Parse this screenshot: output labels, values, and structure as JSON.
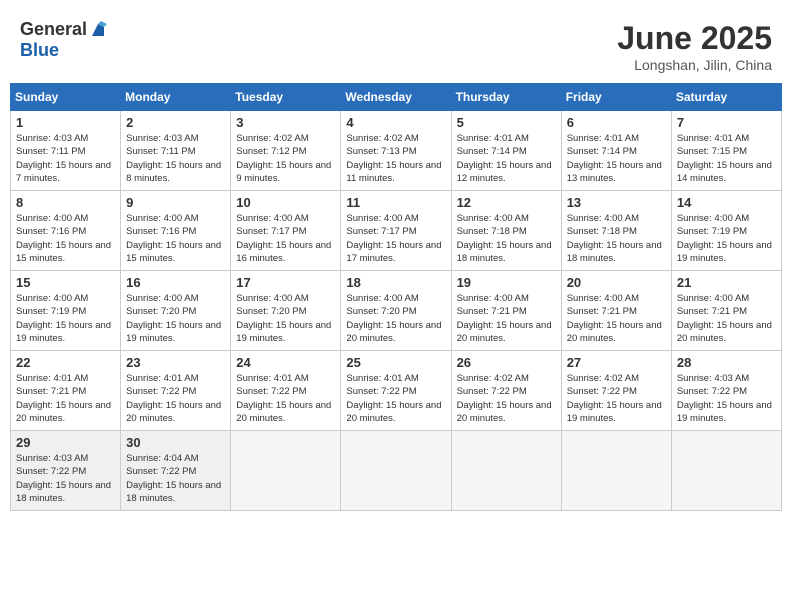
{
  "header": {
    "logo_general": "General",
    "logo_blue": "Blue",
    "title": "June 2025",
    "location": "Longshan, Jilin, China"
  },
  "calendar": {
    "days_of_week": [
      "Sunday",
      "Monday",
      "Tuesday",
      "Wednesday",
      "Thursday",
      "Friday",
      "Saturday"
    ],
    "weeks": [
      [
        null,
        null,
        null,
        null,
        null,
        null,
        null
      ]
    ],
    "cells": [
      {
        "day": null,
        "empty": true
      },
      {
        "day": null,
        "empty": true
      },
      {
        "day": null,
        "empty": true
      },
      {
        "day": null,
        "empty": true
      },
      {
        "day": null,
        "empty": true
      },
      {
        "day": null,
        "empty": true
      },
      {
        "day": null,
        "empty": true
      }
    ],
    "days": [
      {
        "num": "1",
        "sunrise": "4:03 AM",
        "sunset": "7:11 PM",
        "daylight": "15 hours and 7 minutes."
      },
      {
        "num": "2",
        "sunrise": "4:03 AM",
        "sunset": "7:11 PM",
        "daylight": "15 hours and 8 minutes."
      },
      {
        "num": "3",
        "sunrise": "4:02 AM",
        "sunset": "7:12 PM",
        "daylight": "15 hours and 9 minutes."
      },
      {
        "num": "4",
        "sunrise": "4:02 AM",
        "sunset": "7:13 PM",
        "daylight": "15 hours and 11 minutes."
      },
      {
        "num": "5",
        "sunrise": "4:01 AM",
        "sunset": "7:14 PM",
        "daylight": "15 hours and 12 minutes."
      },
      {
        "num": "6",
        "sunrise": "4:01 AM",
        "sunset": "7:14 PM",
        "daylight": "15 hours and 13 minutes."
      },
      {
        "num": "7",
        "sunrise": "4:01 AM",
        "sunset": "7:15 PM",
        "daylight": "15 hours and 14 minutes."
      },
      {
        "num": "8",
        "sunrise": "4:00 AM",
        "sunset": "7:16 PM",
        "daylight": "15 hours and 15 minutes."
      },
      {
        "num": "9",
        "sunrise": "4:00 AM",
        "sunset": "7:16 PM",
        "daylight": "15 hours and 15 minutes."
      },
      {
        "num": "10",
        "sunrise": "4:00 AM",
        "sunset": "7:17 PM",
        "daylight": "15 hours and 16 minutes."
      },
      {
        "num": "11",
        "sunrise": "4:00 AM",
        "sunset": "7:17 PM",
        "daylight": "15 hours and 17 minutes."
      },
      {
        "num": "12",
        "sunrise": "4:00 AM",
        "sunset": "7:18 PM",
        "daylight": "15 hours and 18 minutes."
      },
      {
        "num": "13",
        "sunrise": "4:00 AM",
        "sunset": "7:18 PM",
        "daylight": "15 hours and 18 minutes."
      },
      {
        "num": "14",
        "sunrise": "4:00 AM",
        "sunset": "7:19 PM",
        "daylight": "15 hours and 19 minutes."
      },
      {
        "num": "15",
        "sunrise": "4:00 AM",
        "sunset": "7:19 PM",
        "daylight": "15 hours and 19 minutes."
      },
      {
        "num": "16",
        "sunrise": "4:00 AM",
        "sunset": "7:20 PM",
        "daylight": "15 hours and 19 minutes."
      },
      {
        "num": "17",
        "sunrise": "4:00 AM",
        "sunset": "7:20 PM",
        "daylight": "15 hours and 19 minutes."
      },
      {
        "num": "18",
        "sunrise": "4:00 AM",
        "sunset": "7:20 PM",
        "daylight": "15 hours and 20 minutes."
      },
      {
        "num": "19",
        "sunrise": "4:00 AM",
        "sunset": "7:21 PM",
        "daylight": "15 hours and 20 minutes."
      },
      {
        "num": "20",
        "sunrise": "4:00 AM",
        "sunset": "7:21 PM",
        "daylight": "15 hours and 20 minutes."
      },
      {
        "num": "21",
        "sunrise": "4:00 AM",
        "sunset": "7:21 PM",
        "daylight": "15 hours and 20 minutes."
      },
      {
        "num": "22",
        "sunrise": "4:01 AM",
        "sunset": "7:21 PM",
        "daylight": "15 hours and 20 minutes."
      },
      {
        "num": "23",
        "sunrise": "4:01 AM",
        "sunset": "7:22 PM",
        "daylight": "15 hours and 20 minutes."
      },
      {
        "num": "24",
        "sunrise": "4:01 AM",
        "sunset": "7:22 PM",
        "daylight": "15 hours and 20 minutes."
      },
      {
        "num": "25",
        "sunrise": "4:01 AM",
        "sunset": "7:22 PM",
        "daylight": "15 hours and 20 minutes."
      },
      {
        "num": "26",
        "sunrise": "4:02 AM",
        "sunset": "7:22 PM",
        "daylight": "15 hours and 20 minutes."
      },
      {
        "num": "27",
        "sunrise": "4:02 AM",
        "sunset": "7:22 PM",
        "daylight": "15 hours and 19 minutes."
      },
      {
        "num": "28",
        "sunrise": "4:03 AM",
        "sunset": "7:22 PM",
        "daylight": "15 hours and 19 minutes."
      },
      {
        "num": "29",
        "sunrise": "4:03 AM",
        "sunset": "7:22 PM",
        "daylight": "15 hours and 18 minutes."
      },
      {
        "num": "30",
        "sunrise": "4:04 AM",
        "sunset": "7:22 PM",
        "daylight": "15 hours and 18 minutes."
      }
    ],
    "labels": {
      "sunrise": "Sunrise:",
      "sunset": "Sunset:",
      "daylight": "Daylight:"
    }
  }
}
